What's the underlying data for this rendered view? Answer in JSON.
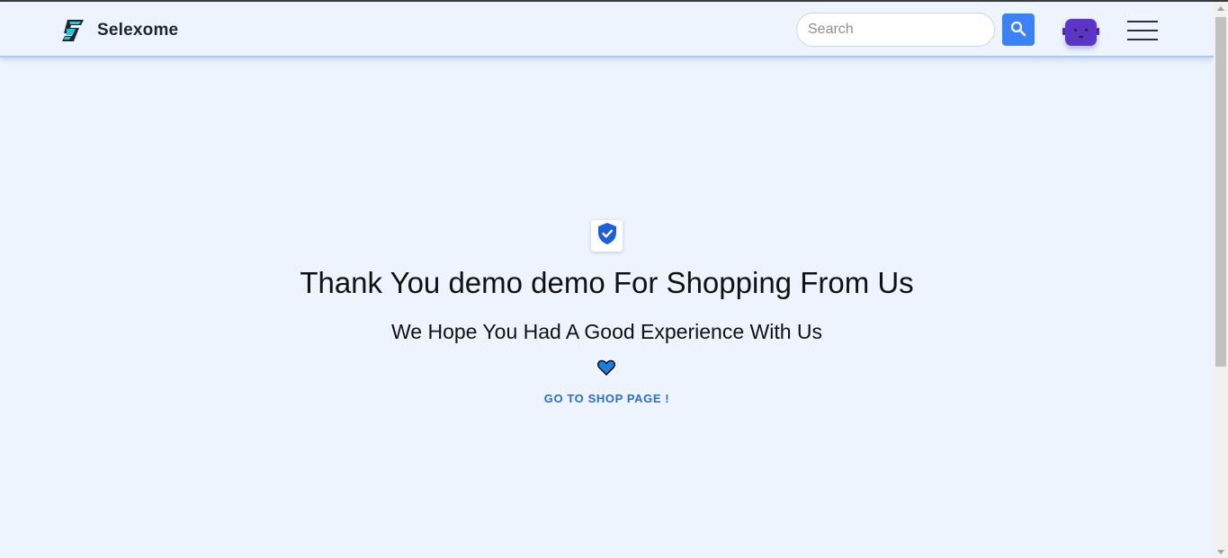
{
  "header": {
    "brand_name": "Selexome",
    "logo_icon": "brand-logo-icon",
    "search": {
      "placeholder": "Search",
      "value": "",
      "button_icon": "search-icon"
    },
    "avatar_icon": "robot-avatar-icon",
    "menu_icon": "hamburger-menu-icon"
  },
  "main": {
    "badge_icon": "verified-shield-icon",
    "title": "Thank You demo demo For Shopping From Us",
    "subtitle": "We Hope You Had A Good Experience With Us",
    "heart_icon": "heart-icon",
    "shop_link_label": "GO TO SHOP PAGE !"
  },
  "colors": {
    "background": "#edf4fd",
    "accent": "#3b82f6",
    "link": "#2a6fc0",
    "avatar": "#5b36c6",
    "brand_text": "#1f2530"
  }
}
